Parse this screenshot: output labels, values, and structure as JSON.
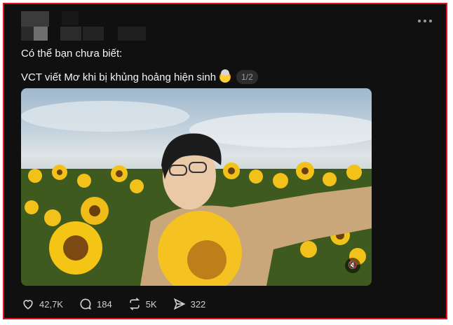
{
  "post": {
    "intro": "Có thể bạn chưa biết:",
    "caption": "VCT viết Mơ khi bị khủng hoảng hiện sinh",
    "emoji_icon": "exploding-head-emoji",
    "carousel_counter": "1/2"
  },
  "actions": {
    "likes": "42,7K",
    "comments": "184",
    "reposts": "5K",
    "shares": "322"
  },
  "colors": {
    "background": "#101010",
    "text": "#f3f5f7",
    "frame_border": "#e0141e"
  }
}
